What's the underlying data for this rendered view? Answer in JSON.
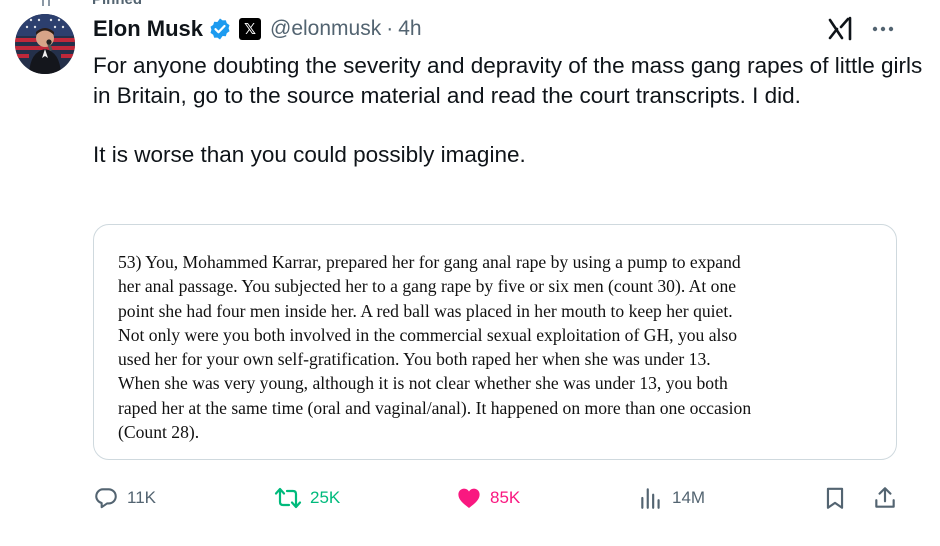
{
  "pinned_label": "Pinned",
  "author": {
    "name": "Elon Musk",
    "handle": "@elonmusk",
    "separator": "·",
    "time": "4h",
    "affiliate_badge": "𝕏"
  },
  "tweet": {
    "paragraphs": [
      "For anyone doubting the severity and depravity of the mass gang rapes of little girls in Britain, go to the source material and read the court transcripts. I did.",
      "It is worse than you could possibly imagine."
    ]
  },
  "quoted_document": {
    "lines": [
      "53)  You, Mohammed Karrar, prepared her for gang anal rape by using a pump to expand",
      "her anal passage.  You subjected her to a gang rape by five or six men (count 30).  At one",
      "point she had four men inside her.  A red ball was placed in her mouth to keep her quiet.",
      "Not only were you both involved in the commercial sexual exploitation of  GH, you also",
      "used her for your own self-gratification.  You both raped her when she was under 13.",
      "When she was very young, although it is not clear whether she was under 13, you both",
      "raped her at the same time (oral and vaginal/anal).  It happened on more than one occasion",
      "(Count 28)."
    ]
  },
  "actions": {
    "replies": "11K",
    "reposts": "25K",
    "likes": "85K",
    "views": "14M"
  },
  "icons": {
    "verified": "verified-badge-icon",
    "grok": "grok-icon",
    "more": "more-icon",
    "reply": "reply-icon",
    "repost": "repost-icon",
    "like": "heart-icon",
    "views": "views-icon",
    "bookmark": "bookmark-icon",
    "share": "share-icon"
  },
  "colors": {
    "text": "#0f1419",
    "secondary": "#536471",
    "verified": "#1d9bf0",
    "repost_active": "#00ba7c",
    "like_active": "#f91880",
    "border": "#cfd9de"
  }
}
